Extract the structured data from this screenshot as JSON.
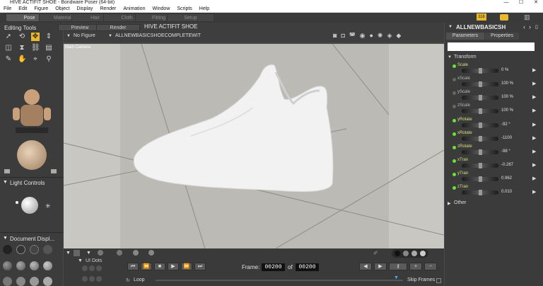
{
  "window": {
    "title": "HIVE ACTIFIT SHOE - Bondware Poser (64-bit)",
    "minimize": "—",
    "maximize": "☐",
    "close": "✕"
  },
  "menu": [
    "File",
    "Edit",
    "Figure",
    "Object",
    "Display",
    "Render",
    "Animation",
    "Window",
    "Scripts",
    "Help"
  ],
  "rooms": [
    "Pose",
    "Material",
    "Hair",
    "Cloth",
    "Fitting",
    "Setup"
  ],
  "active_room": "Pose",
  "top_right": {
    "badge": "116"
  },
  "editing_tools": {
    "title": "Editing Tools"
  },
  "light_controls": {
    "title": "Light Controls"
  },
  "document_display": {
    "title": "Document  Displ..."
  },
  "ui_dots": {
    "title": "UI Dots"
  },
  "viewport": {
    "tabs": [
      "Preview",
      "Render"
    ],
    "doc_title": "HIVE ACTIFIT SHOE",
    "figure_select": "No Figure",
    "prop_select": "ALLNEWBASICSHOECOMPLETEWIT",
    "camera_label": "Main Camera"
  },
  "timeline": {
    "frame_label": "Frame:",
    "current_frame": "00200",
    "of_label": "of",
    "total_frames": "00200",
    "loop_label": "Loop",
    "skip_frames_label": "Skip Frames"
  },
  "parameters": {
    "object_name": "ALLNEWBASICSH",
    "tabs": [
      "Parameters",
      "Properties"
    ],
    "search_value": "",
    "group_transform": "Transform",
    "group_other": "Other",
    "rows": [
      {
        "label": "Scale",
        "value": "0 %",
        "active": true
      },
      {
        "label": "xScale",
        "value": "100 %",
        "active": false
      },
      {
        "label": "yScale",
        "value": "100 %",
        "active": false
      },
      {
        "label": "zScale",
        "value": "100 %",
        "active": false
      },
      {
        "label": "yRotate",
        "value": "-92 °",
        "active": true
      },
      {
        "label": "xRotate",
        "value": "-1100",
        "active": true
      },
      {
        "label": "zRotate",
        "value": "-98 °",
        "active": true
      },
      {
        "label": "xTran",
        "value": "-0.287",
        "active": true
      },
      {
        "label": "yTran",
        "value": "0.962",
        "active": true
      },
      {
        "label": "zTran",
        "value": "0.010",
        "active": true
      }
    ]
  },
  "colors": {
    "accent_green": "#6be03a",
    "label_yellow": "#d9e07a",
    "viewport_bg": "#c7c5c0"
  }
}
